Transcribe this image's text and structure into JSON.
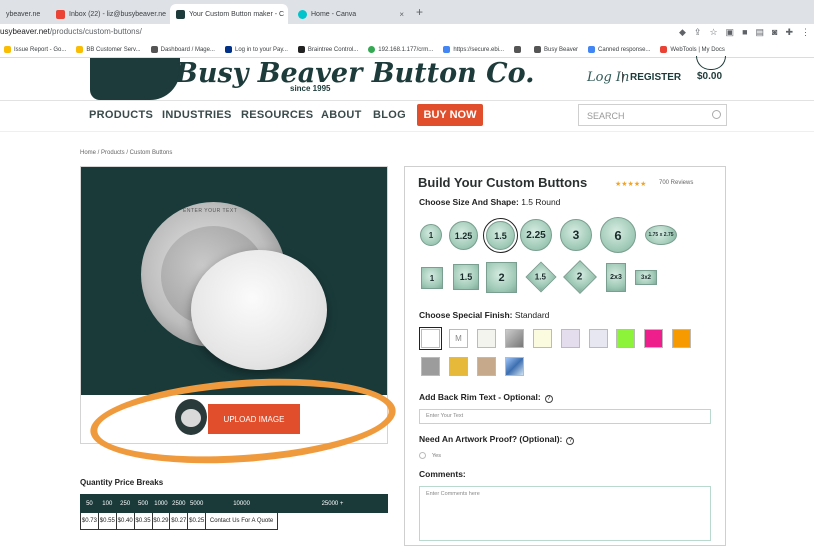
{
  "browser": {
    "tabs": [
      {
        "label": "ybeaver.ne",
        "favicon_color": "#e8a33d",
        "active": false
      },
      {
        "label": "Inbox (22) - liz@busybeaver.ne",
        "favicon_color": "#ea4335",
        "active": false
      },
      {
        "label": "Your Custom Button maker - C",
        "favicon_color": "#1d3b3a",
        "active": true
      },
      {
        "label": "Home - Canva",
        "favicon_color": "#00c4cc",
        "active": false
      }
    ],
    "url_host": "usybeaver.net",
    "url_path": "/products/custom-buttons/",
    "bookmarks": [
      {
        "label": "Issue Report - Go...",
        "color": "#fbbc04"
      },
      {
        "label": "BB Customer Serv...",
        "color": "#fbbc04"
      },
      {
        "label": "Dashboard / Mage...",
        "color": "#555555"
      },
      {
        "label": "Log in to your Pay...",
        "color": "#003087"
      },
      {
        "label": "Braintree Control...",
        "color": "#222222"
      },
      {
        "label": "192.168.1.177/crm...",
        "color": "#34a853"
      },
      {
        "label": "https://secure.ebi...",
        "color": "#4285f4"
      },
      {
        "label": "",
        "color": "#555555"
      },
      {
        "label": "Busy Beaver",
        "color": "#555555"
      },
      {
        "label": "Canned response...",
        "color": "#4285f4"
      },
      {
        "label": "WebTools | My Docs",
        "color": "#ea4335"
      }
    ]
  },
  "header": {
    "logo_text": "Busy Beaver Button Co.",
    "since": "since 1995",
    "login": "Log In",
    "separator": "|",
    "register": "REGISTER",
    "cart_total": "$0.00"
  },
  "nav": {
    "items": [
      "PRODUCTS",
      "INDUSTRIES",
      "RESOURCES",
      "ABOUT",
      "BLOG"
    ],
    "buy_now": "BUY NOW",
    "search_placeholder": "SEARCH"
  },
  "breadcrumb": "Home  /  Products  /  Custom Buttons",
  "preview": {
    "rim_text": "ENTER YOUR TEXT",
    "upload_label": "UPLOAD IMAGE"
  },
  "pricing": {
    "title": "Quantity Price Breaks",
    "quantities": [
      "50",
      "100",
      "250",
      "500",
      "1000",
      "2500",
      "5000",
      "10000",
      "25000 +"
    ],
    "prices": [
      "$0.73",
      "$0.55",
      "$0.40",
      "$0.35",
      "$0.29",
      "$0.27",
      "$0.25",
      "Contact Us For A Quote"
    ]
  },
  "builder": {
    "title": "Build Your Custom Buttons",
    "stars": "★★★★★",
    "reviews": "700 Reviews",
    "size_label": "Choose Size And Shape:",
    "size_value": "1.5 Round",
    "round_sizes": [
      "1",
      "1.25",
      "1.5",
      "2.25",
      "3",
      "6",
      "1.75 x 2.75"
    ],
    "square_sizes": [
      "1",
      "1.5",
      "2",
      "1.5",
      "2",
      "2x3",
      "3x2"
    ],
    "finish_label": "Choose Special Finish:",
    "finish_value": "Standard",
    "finish_swatch_text": "M",
    "finish_colors": [
      "#ffffff",
      "#ffffff",
      "#f4f4ee",
      "#9a9a9a",
      "#fbfbe0",
      "#e4ddee",
      "#e7e7f1",
      "#8df23a",
      "#ee1f8d",
      "#f79a00",
      "#9c9c9c",
      "#e6b93a",
      "#c6a98b",
      "#6fa8dc"
    ],
    "rim_label": "Add Back Rim Text - Optional:",
    "rim_placeholder": "Enter Your Text",
    "proof_label": "Need An Artwork Proof? (Optional):",
    "proof_yes": "Yes",
    "comments_label": "Comments:",
    "comments_placeholder": "Enter Comments here"
  }
}
